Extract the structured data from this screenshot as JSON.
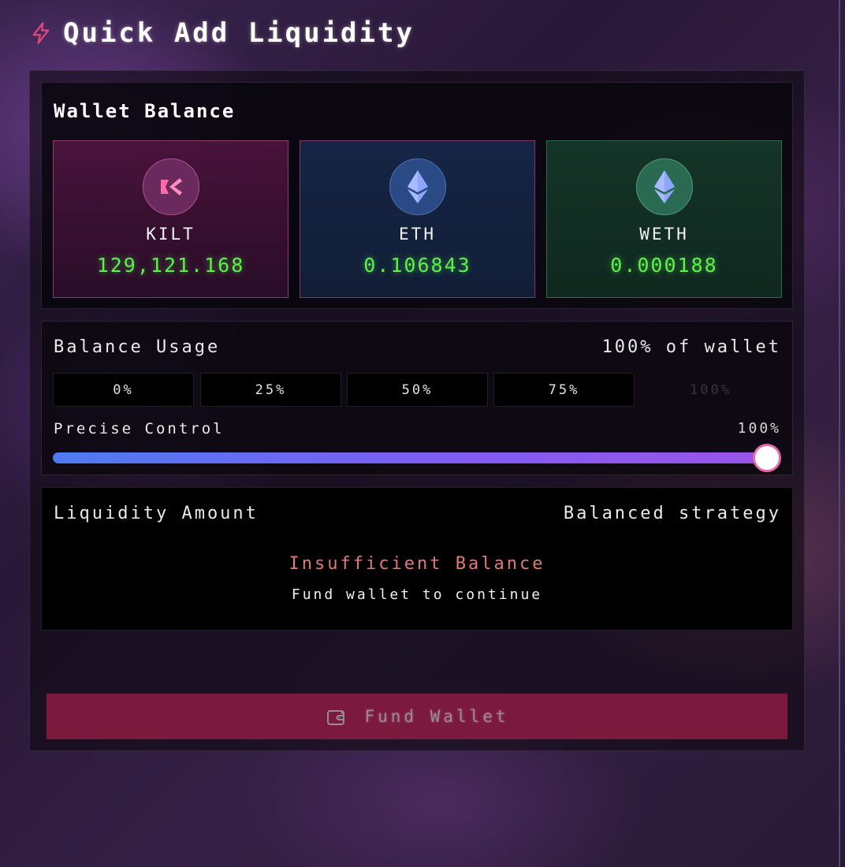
{
  "page": {
    "title": "Quick Add Liquidity",
    "title_icon": "lightning-bolt-icon"
  },
  "wallet": {
    "title": "Wallet Balance",
    "tokens": [
      {
        "symbol": "KILT",
        "amount": "129,121.168",
        "icon": "kilt-logo-icon"
      },
      {
        "symbol": "ETH",
        "amount": "0.106843",
        "icon": "ethereum-icon"
      },
      {
        "symbol": "WETH",
        "amount": "0.000188",
        "icon": "ethereum-icon"
      }
    ]
  },
  "usage": {
    "label": "Balance Usage",
    "value": "100% of wallet",
    "presets": [
      "0%",
      "25%",
      "50%",
      "75%",
      "100%"
    ],
    "selected_preset": "100%",
    "precise_label": "Precise Control",
    "precise_value": "100%",
    "slider_fraction": 1.0
  },
  "liquidity": {
    "label": "Liquidity Amount",
    "strategy": "Balanced strategy",
    "warning_title": "Insufficient Balance",
    "warning_subtitle": "Fund wallet to continue"
  },
  "action": {
    "label": "Fund Wallet",
    "icon": "wallet-icon"
  },
  "colors": {
    "accent": "#e0457b",
    "balance_green": "#5ef04a",
    "warning": "#e07a7a",
    "fund_button": "#7c1a3e"
  }
}
